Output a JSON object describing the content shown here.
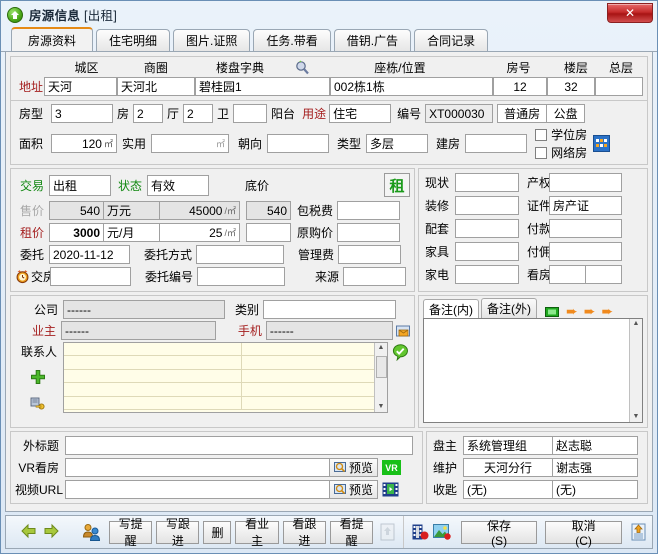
{
  "window": {
    "title": "房源信息",
    "title_suffix": "[出租]",
    "close_label": "✕",
    "icon": "house-up-arrow-icon"
  },
  "tabs": [
    {
      "label": "房源资料",
      "active": true
    },
    {
      "label": "住宅明细",
      "active": false
    },
    {
      "label": "图片.证照",
      "active": false
    },
    {
      "label": "任务.带看",
      "active": false
    },
    {
      "label": "借钥.广告",
      "active": false
    },
    {
      "label": "合同记录",
      "active": false
    }
  ],
  "address": {
    "label": "地址",
    "headers": {
      "district": "城区",
      "business_area": "商圈",
      "building_dict": "楼盘字典",
      "position": "座栋/位置",
      "room_no": "房号",
      "floor": "楼层",
      "total_floor": "总层"
    },
    "values": {
      "district": "天河",
      "business_area": "天河北",
      "building_dict": "碧桂园1",
      "position": "002栋1栋",
      "room_no": "12",
      "floor": "32",
      "total_floor": ""
    },
    "search_icon": "magnifier-icon"
  },
  "layout": {
    "type_label": "房型",
    "rooms": "3",
    "rooms_unit": "房",
    "halls": "2",
    "halls_unit": "厅",
    "baths": "2",
    "baths_unit": "卫",
    "balcony_label": "阳台",
    "balcony": "",
    "usage_label": "用途",
    "usage": "住宅",
    "code_label": "编号",
    "code": "XT000030",
    "normal_house": "普通房",
    "public_listing": "公盘",
    "area_label": "面积",
    "area": "120",
    "area_unit": "㎡",
    "usable_label": "实用",
    "usable": "",
    "usable_unit": "㎡",
    "orientation_label": "朝向",
    "orientation": "",
    "structure_label": "类型",
    "structure": "多层",
    "built_label": "建房",
    "built": "",
    "school_house": "学位房",
    "network_house": "网络房",
    "grid_icon": "grid-icon"
  },
  "trade": {
    "trade_label": "交易",
    "trade_value": "出租",
    "status_label": "状态",
    "status_value": "有效",
    "base_price_label": "底价",
    "badge": "租",
    "sale_label": "售价",
    "sale_price": "540",
    "sale_unit": "万元",
    "sale_per_sqm": "45000",
    "sale_per_sqm_unit": "/㎡",
    "sale_base": "540",
    "tax_label": "包税费",
    "tax_value": "",
    "rent_label": "租价",
    "rent_price": "3000",
    "rent_unit": "元/月",
    "rent_per_sqm": "25",
    "rent_per_sqm_unit": "/㎡",
    "rent_base": "",
    "orig_price_label": "原购价",
    "orig_price": "",
    "entrust_label": "委托",
    "entrust_date": "2020-11-12",
    "entrust_way_label": "委托方式",
    "entrust_way": "",
    "mgmt_fee_label": "管理费",
    "mgmt_fee": "",
    "handover_label": "交房",
    "handover": "",
    "entrust_no_label": "委托编号",
    "entrust_no": "",
    "source_label": "来源",
    "source": "",
    "clock_icon": "alarm-clock-icon"
  },
  "condition": {
    "current_label": "现状",
    "current": "",
    "ownership_label": "产权",
    "ownership": "",
    "decoration_label": "装修",
    "decoration": "",
    "cert_label": "证件",
    "cert": "房产证",
    "facility_label": "配套",
    "facility": "",
    "payment_label": "付款",
    "payment": "",
    "furniture_label": "家具",
    "furniture": "",
    "commission_label": "付佣",
    "commission": "",
    "appliance_label": "家电",
    "appliance": "",
    "viewing_label": "看房",
    "viewing_a": "",
    "viewing_b": ""
  },
  "contact": {
    "company_label": "公司",
    "company": "------",
    "category_label": "类别",
    "category": "",
    "owner_label": "业主",
    "owner": "------",
    "mobile_label": "手机",
    "mobile": "------",
    "contacts_label": "联系人",
    "add_icon": "plus-icon",
    "phone_icon": "phone-key-icon",
    "mail_icon": "mail-icon",
    "verify_icon": "green-check-balloon-icon",
    "rows": [
      "",
      "",
      "",
      "",
      ""
    ]
  },
  "notes": {
    "tab_internal": "备注(内)",
    "tab_external": "备注(外)",
    "text": "",
    "copy_icon": "copy-icon",
    "arrow_icon": "arrow-right-icon"
  },
  "media": {
    "outer_title_label": "外标题",
    "outer_title": "",
    "vr_label": "VR看房",
    "vr_url": "",
    "video_label": "视频URL",
    "video_url": "",
    "preview_label": "预览",
    "preview_icon": "magnifier-image-icon",
    "vr_badge": "VR",
    "video_badge": "film-icon"
  },
  "ownership_info": {
    "owner_group_label": "盘主",
    "owner_group": "系统管理组",
    "owner_person": "赵志聪",
    "maintainer_label": "维护",
    "maintainer_branch": "天河分行",
    "maintainer_person": "谢志强",
    "key_label": "收匙",
    "key_a": "(无)",
    "key_b": "(无)"
  },
  "bottombar": {
    "prev_icon": "arrow-left-icon",
    "next_icon": "arrow-right-icon",
    "people_icon": "people-icon",
    "buttons": [
      {
        "label": "写提醒"
      },
      {
        "label": "写跟进"
      },
      {
        "label": "删"
      },
      {
        "label": "看业主"
      },
      {
        "label": "看跟进"
      },
      {
        "label": "看提醒"
      }
    ],
    "upload_icon": "upload-icon",
    "film_icon": "film-icon",
    "image_icon": "image-icon",
    "save_label": "保存(S)",
    "cancel_label": "取消(C)",
    "export_icon": "export-icon"
  },
  "colors": {
    "accent_orange": "#e58a16",
    "label_red": "#a52020",
    "label_green": "#118811",
    "badge_green": "#1a9a1a",
    "list_yellow": "#fffde8",
    "close_red": "#c62b2b"
  }
}
